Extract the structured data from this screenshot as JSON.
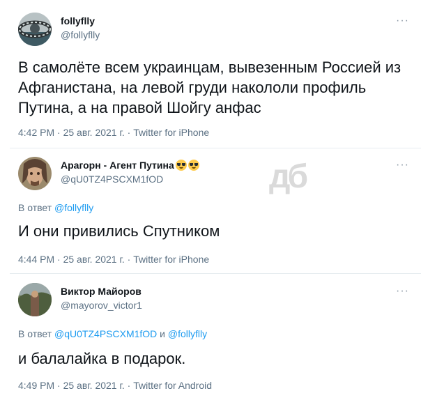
{
  "tweets": [
    {
      "name": "follyflly",
      "handle": "@follyflly",
      "text_lines": [
        "В самолёте всем украинцам, вывезенным Россией из",
        "Афганистана, на левой груди накололи профиль",
        "Путина, а на правой Шойгу анфас"
      ],
      "meta": "4:42 PM · 25 авг. 2021 г. · Twitter for iPhone",
      "more": "···"
    },
    {
      "name": "Арагорн - Агент Путина",
      "emoji": [
        "smiling-face-with-sunglasses",
        "smiling-face-with-sunglasses"
      ],
      "handle": "@qU0TZ4PSCXM1fOD",
      "reply_prefix": "В ответ ",
      "reply_mention": "@follyflly",
      "text": "И они привились Спутником",
      "meta": "4:44 PM · 25 авг. 2021 г. · Twitter for iPhone",
      "more": "···"
    },
    {
      "name": "Виктор Майоров",
      "handle": "@mayorov_victor1",
      "reply_prefix": "В ответ ",
      "reply_mention_1": "@qU0TZ4PSCXM1fOD",
      "reply_join": " и ",
      "reply_mention_2": "@follyflly",
      "text": "и балалайка в подарок.",
      "meta": "4:49 PM · 25 авг. 2021 г. · Twitter for Android",
      "more": "···"
    }
  ],
  "watermark": "дб"
}
